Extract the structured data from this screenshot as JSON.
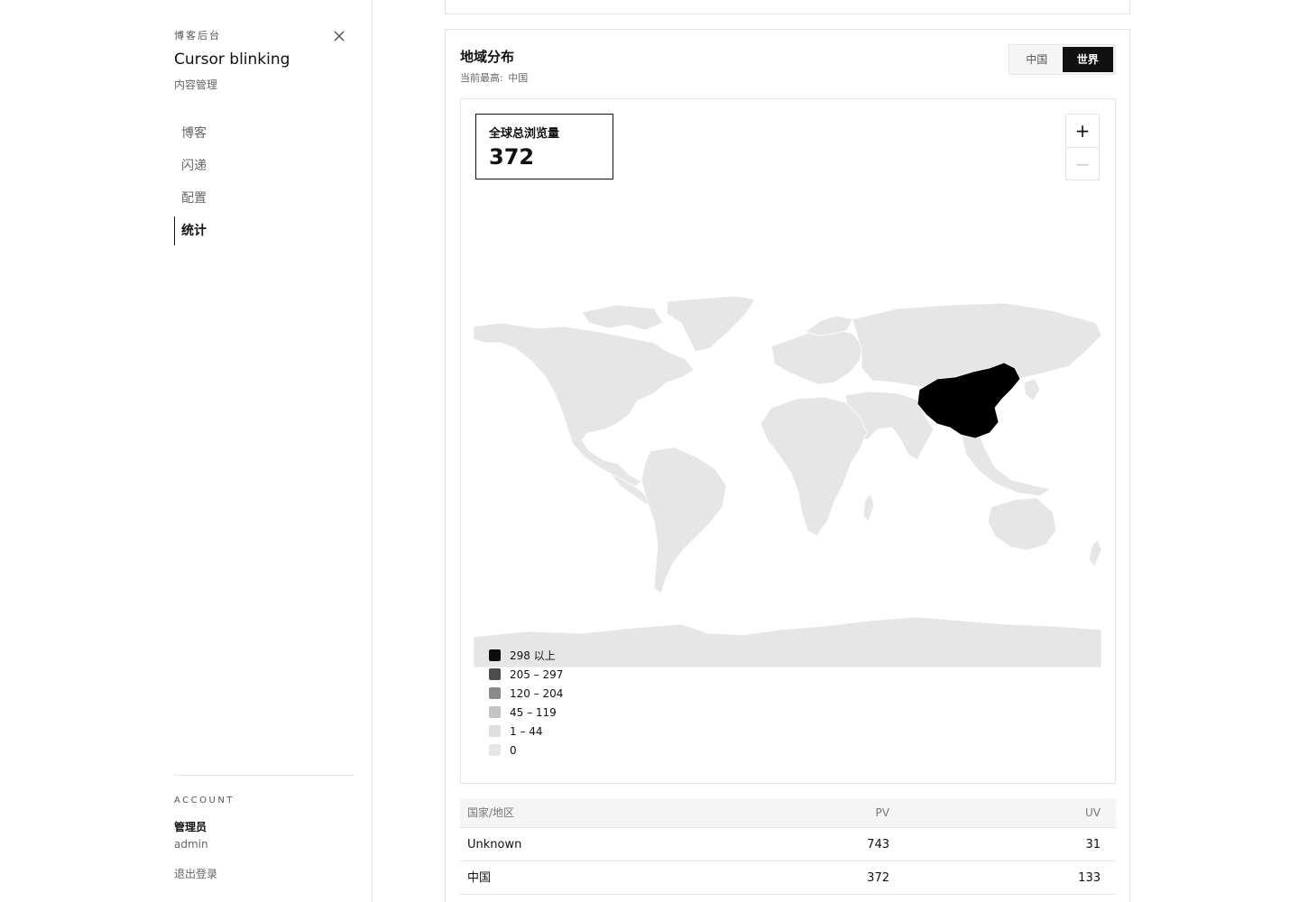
{
  "sidebar": {
    "kicker": "博客后台",
    "site_title": "Cursor blinking",
    "site_subtitle": "内容管理",
    "nav": [
      {
        "label": "博客",
        "active": false
      },
      {
        "label": "闪递",
        "active": false
      },
      {
        "label": "配置",
        "active": false
      },
      {
        "label": "统计",
        "active": true
      }
    ],
    "account": {
      "section_label": "ACCOUNT",
      "role": "管理员",
      "username": "admin",
      "logout_label": "退出登录"
    }
  },
  "region_card": {
    "title": "地域分布",
    "subtitle_prefix": "当前最高:",
    "subtitle_value": "中国",
    "scope_toggle": {
      "options": [
        "中国",
        "世界"
      ],
      "selected": "世界"
    },
    "total": {
      "label": "全球总浏览量",
      "value": "372"
    },
    "zoom": {
      "in": "+",
      "out": "−"
    },
    "highlighted_country": "China",
    "legend": [
      {
        "label": "298 以上",
        "color": "#0d0d0d"
      },
      {
        "label": "205 – 297",
        "color": "#4d4d4d"
      },
      {
        "label": "120 – 204",
        "color": "#8a8a8a"
      },
      {
        "label": "45 – 119",
        "color": "#c4c4c4"
      },
      {
        "label": "1 – 44",
        "color": "#dedede"
      },
      {
        "label": "0",
        "color": "#e6e6e6"
      }
    ],
    "table": {
      "headers": [
        "国家/地区",
        "PV",
        "UV"
      ],
      "rows": [
        [
          "Unknown",
          "743",
          "31"
        ],
        [
          "中国",
          "372",
          "133"
        ]
      ]
    }
  }
}
